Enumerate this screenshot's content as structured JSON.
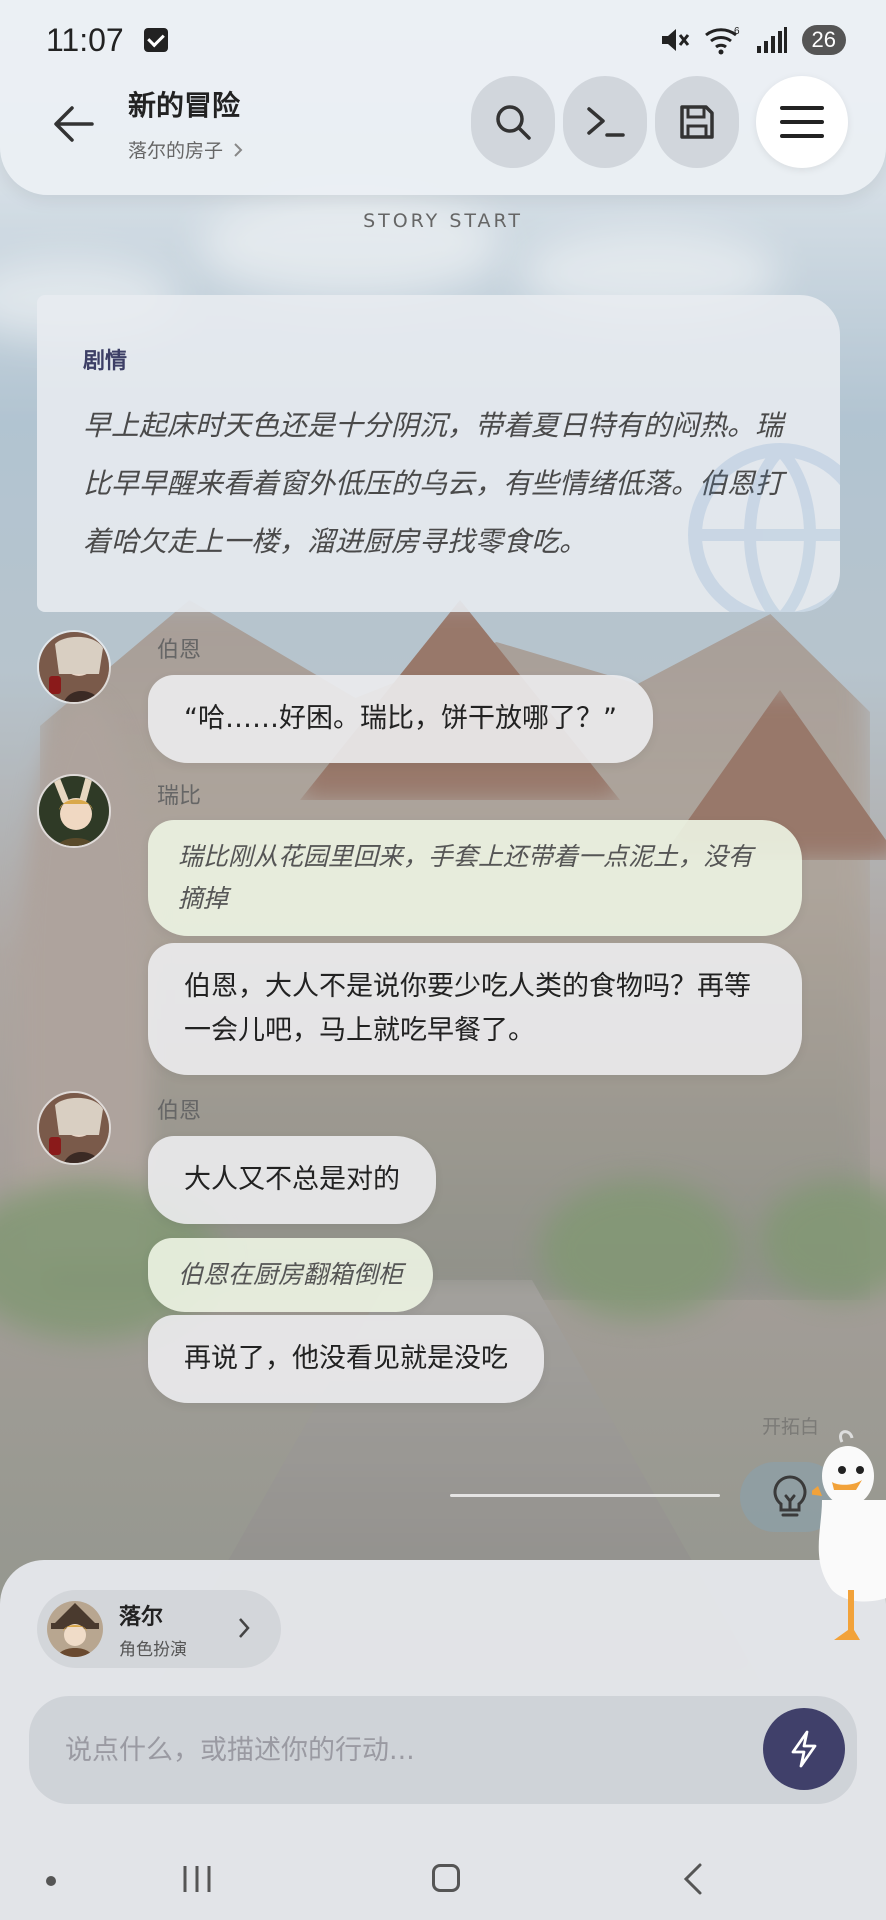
{
  "status_bar": {
    "time": "11:07",
    "battery": "26",
    "wifi_badge": "6"
  },
  "header": {
    "title": "新的冒险",
    "subtitle": "落尔的房子",
    "buttons": [
      "search-icon",
      "terminal-icon",
      "save-icon",
      "menu-icon"
    ]
  },
  "story_start": "STORY START",
  "narration": {
    "label": "剧情",
    "text": "早上起床时天色还是十分阴沉，带着夏日特有的闷热。瑞比早早醒来看着窗外低压的乌云，有些情绪低落。伯恩打着哈欠走上一楼，溜进厨房寻找零食吃。"
  },
  "messages": [
    {
      "speaker": "伯恩",
      "bubbles": [
        {
          "type": "speech",
          "text": "“哈……好困。瑞比，饼干放哪了？”"
        }
      ]
    },
    {
      "speaker": "瑞比",
      "bubbles": [
        {
          "type": "action",
          "text": "瑞比刚从花园里回来，手套上还带着一点泥土，没有摘掉"
        },
        {
          "type": "speech",
          "text": "伯恩，大人不是说你要少吃人类的食物吗？再等一会儿吧，马上就吃早餐了。"
        }
      ]
    },
    {
      "speaker": "伯恩",
      "bubbles": [
        {
          "type": "speech",
          "text": "大人又不总是对的"
        },
        {
          "type": "action",
          "text": "伯恩在厨房翻箱倒柜"
        },
        {
          "type": "speech",
          "text": "再说了，他没看见就是没吃"
        }
      ]
    }
  ],
  "hint": {
    "label": "开拓白"
  },
  "persona": {
    "name": "落尔",
    "role": "角色扮演"
  },
  "input": {
    "placeholder": "说点什么，或描述你的行动...",
    "value": ""
  },
  "colors": {
    "accent": "#40406a",
    "header_bg": "#eceff3",
    "action_bubble": "#ecf2e2"
  }
}
